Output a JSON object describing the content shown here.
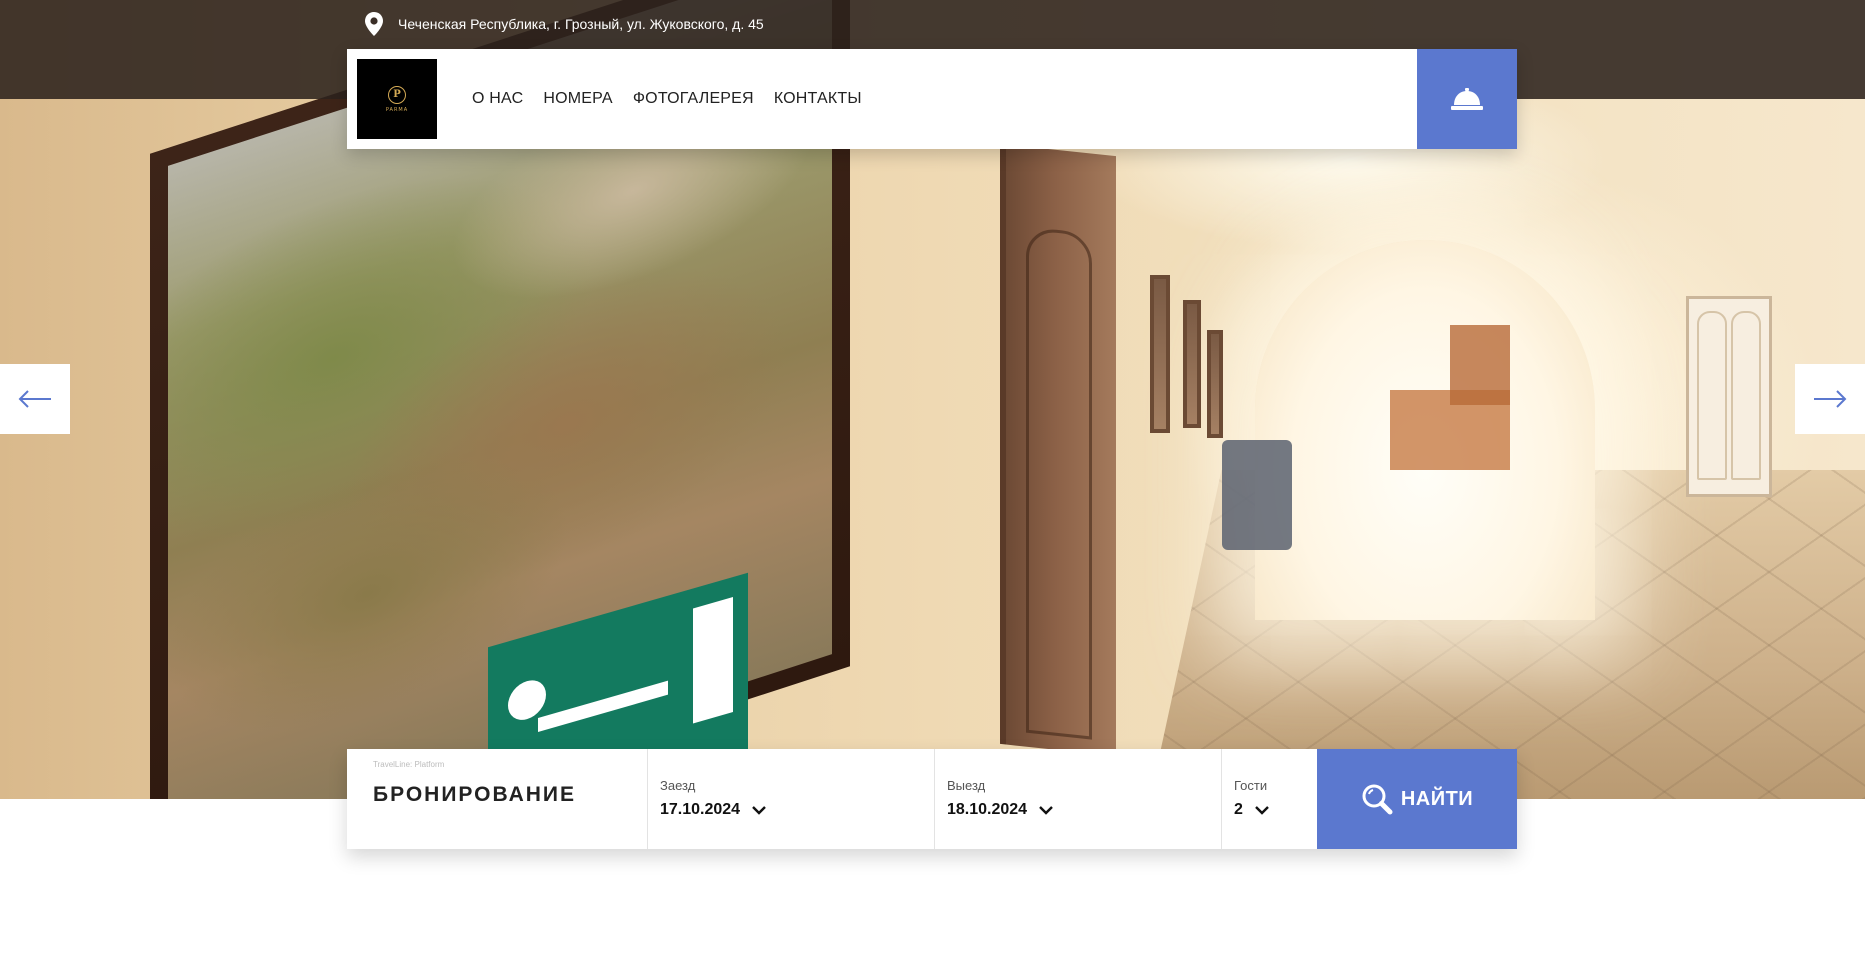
{
  "topbar": {
    "address": "Чеченская Республика, г. Грозный, ул. Жуковского, д. 45",
    "icon": "map-pin-icon"
  },
  "nav": {
    "logo": {
      "mark": "P",
      "text": "PARMA"
    },
    "items": [
      {
        "label": "О НАС"
      },
      {
        "label": "НОМЕРА"
      },
      {
        "label": "ФОТОГАЛЕРЕЯ"
      },
      {
        "label": "КОНТАКТЫ"
      }
    ],
    "booking_icon": "reception-bell-icon"
  },
  "slider": {
    "prev_icon": "arrow-left-icon",
    "next_icon": "arrow-right-icon"
  },
  "booking": {
    "powered_by": "TravelLine: Platform",
    "title": "БРОНИРОВАНИЕ",
    "check_in": {
      "label": "Заезд",
      "value": "17.10.2024"
    },
    "check_out": {
      "label": "Выезд",
      "value": "18.10.2024"
    },
    "guests": {
      "label": "Гости",
      "value": "2"
    },
    "search_label": "НАЙТИ"
  },
  "colors": {
    "accent": "#5b78cf",
    "topbar": "#2c221c",
    "text": "#222222"
  }
}
